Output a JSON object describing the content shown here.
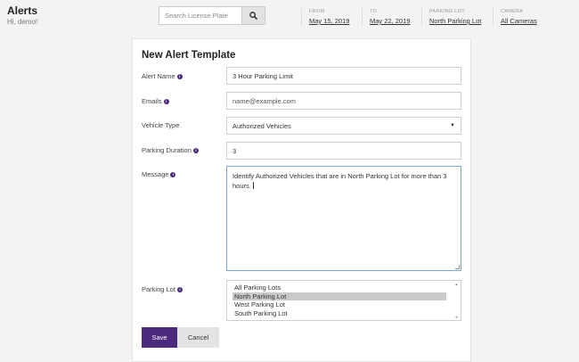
{
  "header": {
    "title": "Alerts",
    "greeting": "Hi, demo!"
  },
  "search": {
    "placeholder": "Search License Plate",
    "icon": "search-icon"
  },
  "filters": [
    {
      "label": "FROM",
      "value": "May 15, 2019"
    },
    {
      "label": "TO",
      "value": "May 22, 2019"
    },
    {
      "label": "PARKING LOT",
      "value": "North Parking Lot"
    },
    {
      "label": "CAMERA",
      "value": "All Cameras"
    }
  ],
  "form": {
    "title": "New Alert Template",
    "alert_name": {
      "label": "Alert Name",
      "value": "3 Hour Parking Limit"
    },
    "emails": {
      "label": "Emails",
      "placeholder": "name@example.com"
    },
    "vehicle_type": {
      "label": "Vehicle Type",
      "value": "Authorized Vehicles"
    },
    "parking_duration": {
      "label": "Parking Duration",
      "value": "3"
    },
    "message": {
      "label": "Message",
      "value": "Identify Authorized Vehicles that are in North Parking Lot for more than 3 hours."
    },
    "parking_lot": {
      "label": "Parking Lot",
      "options": [
        "All Parking Lots",
        "North Parking Lot",
        "West Parking Lot",
        "South Parking Lot"
      ],
      "selected": "North Parking Lot"
    },
    "save_label": "Save",
    "cancel_label": "Cancel"
  },
  "colors": {
    "accent": "#4b2a7e",
    "background": "#f3f3f5",
    "button_secondary": "#e3e3e6",
    "focus_border": "#7aa7d6"
  }
}
